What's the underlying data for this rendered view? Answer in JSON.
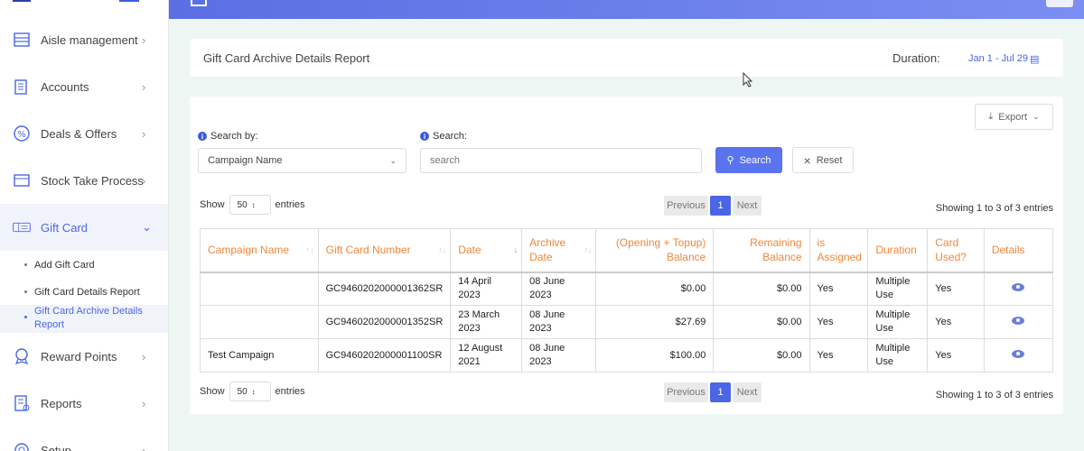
{
  "sidebar": {
    "items": [
      {
        "label": "Aisle management",
        "icon": "aisle-icon"
      },
      {
        "label": "Accounts",
        "icon": "accounts-icon"
      },
      {
        "label": "Deals & Offers",
        "icon": "percent-icon"
      },
      {
        "label": "Stock Take Process",
        "icon": "stock-icon"
      },
      {
        "label": "Gift Card",
        "icon": "gift-card-icon"
      },
      {
        "label": "Reward Points",
        "icon": "reward-icon"
      },
      {
        "label": "Reports",
        "icon": "reports-icon"
      },
      {
        "label": "Setup",
        "icon": "setup-icon"
      }
    ],
    "gift_card_sub": [
      {
        "label": "Add Gift Card"
      },
      {
        "label": "Gift Card Details Report"
      },
      {
        "label": "Gift Card Archive Details Report"
      }
    ]
  },
  "header": {
    "title": "Gift Card Archive Details Report",
    "duration_label": "Duration:",
    "duration_value": "Jan 1 - Jul 29"
  },
  "controls": {
    "export_label": "Export",
    "search_by_label": "Search by:",
    "search_by_value": "Campaign Name",
    "search_label": "Search:",
    "search_placeholder": "search",
    "search_button": "Search",
    "reset_button": "Reset",
    "show_label": "Show",
    "entries_label": "entries",
    "page_length": "50",
    "prev_label": "Previous",
    "page_num": "1",
    "next_label": "Next",
    "showing_text": "Showing 1 to 3 of 3 entries"
  },
  "table": {
    "headers": [
      "Campaign Name",
      "Gift Card Number",
      "Date",
      "Archive Date",
      "(Opening + Topup) Balance",
      "Remaining Balance",
      "is Assigned",
      "Duration",
      "Card Used?",
      "Details"
    ],
    "rows": [
      {
        "campaign": "",
        "number": "GC9460202000001362SR",
        "date": "14 April 2023",
        "archive_date": "08 June 2023",
        "balance": "$0.00",
        "remaining": "$0.00",
        "assigned": "Yes",
        "duration": "Multiple Use",
        "used": "Yes"
      },
      {
        "campaign": "",
        "number": "GC9460202000001352SR",
        "date": "23 March 2023",
        "archive_date": "08 June 2023",
        "balance": "$27.69",
        "remaining": "$0.00",
        "assigned": "Yes",
        "duration": "Multiple Use",
        "used": "Yes"
      },
      {
        "campaign": "Test Campaign",
        "number": "GC9460202000001100SR",
        "date": "12 August 2021",
        "archive_date": "08 June 2023",
        "balance": "$100.00",
        "remaining": "$0.00",
        "assigned": "Yes",
        "duration": "Multiple Use",
        "used": "Yes"
      }
    ]
  },
  "colors": {
    "accent": "#4a66e4",
    "header_text": "#f0873a"
  }
}
